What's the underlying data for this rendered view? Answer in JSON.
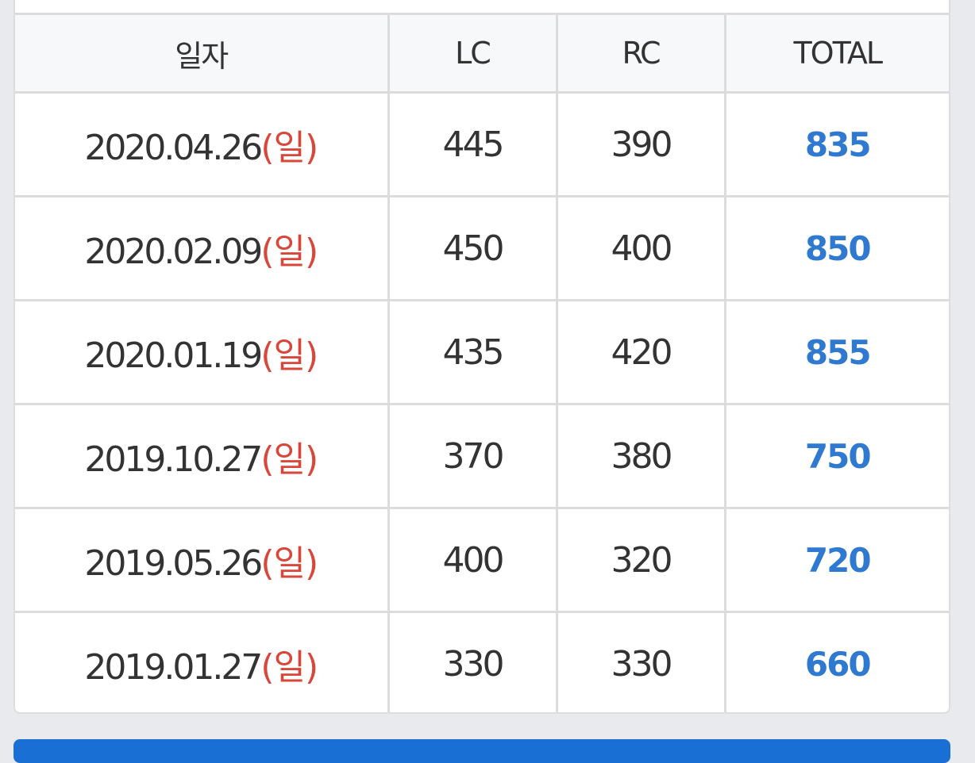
{
  "table": {
    "headers": {
      "date": "일자",
      "lc": "LC",
      "rc": "RC",
      "total": "TOTAL"
    },
    "rows": [
      {
        "date": "2020.04.26",
        "weekday": "(일)",
        "lc": "445",
        "rc": "390",
        "total": "835"
      },
      {
        "date": "2020.02.09",
        "weekday": "(일)",
        "lc": "450",
        "rc": "400",
        "total": "850"
      },
      {
        "date": "2020.01.19",
        "weekday": "(일)",
        "lc": "435",
        "rc": "420",
        "total": "855"
      },
      {
        "date": "2019.10.27",
        "weekday": "(일)",
        "lc": "370",
        "rc": "380",
        "total": "750"
      },
      {
        "date": "2019.05.26",
        "weekday": "(일)",
        "lc": "400",
        "rc": "320",
        "total": "720"
      },
      {
        "date": "2019.01.27",
        "weekday": "(일)",
        "lc": "330",
        "rc": "330",
        "total": "660"
      }
    ]
  },
  "colors": {
    "weekday_red": "#d9463a",
    "total_blue": "#2f7ad0",
    "button_blue": "#1a6fd4"
  }
}
